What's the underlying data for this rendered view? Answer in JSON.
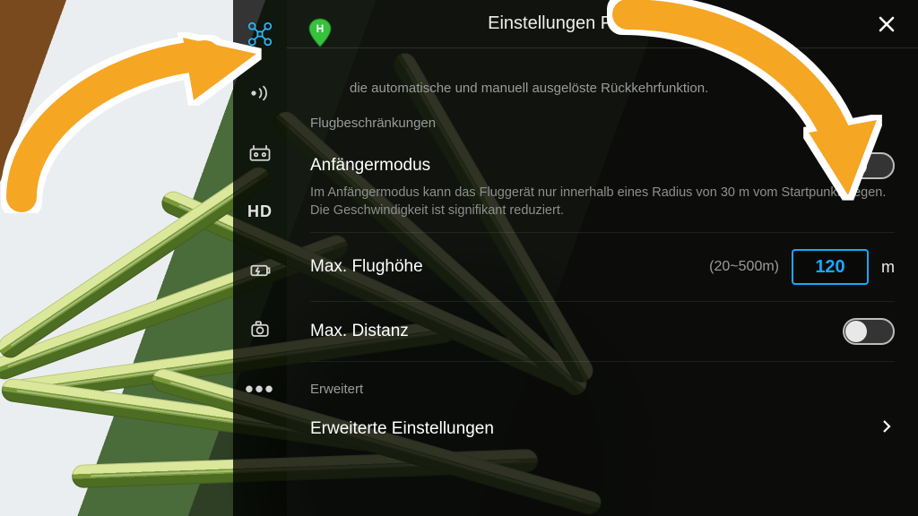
{
  "header": {
    "title": "Einstellungen Fernsteuerung"
  },
  "top_note": "die automatische und manuell ausgelöste Rückkehrfunktion.",
  "sections": {
    "restrictions_label": "Flugbeschränkungen",
    "beginner": {
      "label": "Anfängermodus",
      "desc": "Im Anfängermodus kann das Fluggerät nur innerhalb eines Radius von 30 m vom Startpunkt fliegen. Die Geschwindigkeit ist signifikant reduziert.",
      "enabled": false
    },
    "max_altitude": {
      "label": "Max. Flughöhe",
      "range": "(20~500m)",
      "value": "120",
      "unit": "m"
    },
    "max_distance": {
      "label": "Max. Distanz",
      "enabled": false
    },
    "advanced_label": "Erweitert",
    "advanced_row": "Erweiterte Einstellungen"
  },
  "rail": {
    "hd": "HD",
    "more": "•••"
  },
  "colors": {
    "accent": "#1aa7ff",
    "arrow": "#f5a623"
  }
}
